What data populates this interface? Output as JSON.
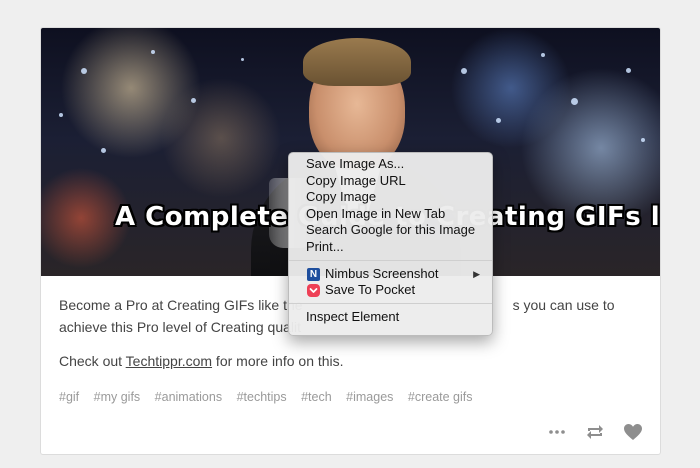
{
  "post": {
    "image_caption": "A Complete Guide to Creating GIFs like this",
    "paragraph1_start": "Become a Pro at Creating GIFs like the",
    "paragraph1_mid": "s you can use to",
    "paragraph1_line2": "achieve this Pro level of Creating qualit",
    "paragraph2_prefix": "Check out ",
    "paragraph2_link": "Techtippr.com",
    "paragraph2_suffix": " for more info on this.",
    "tags": [
      "#gif",
      "#my gifs",
      "#animations",
      "#techtips",
      "#tech",
      "#images",
      "#create gifs"
    ]
  },
  "actions": {
    "more_icon": "more-dots-icon",
    "reblog_icon": "reblog-icon",
    "like_icon": "heart-icon"
  },
  "context_menu": {
    "items": [
      "Save Image As...",
      "Copy Image URL",
      "Copy Image",
      "Open Image in New Tab",
      "Search Google for this Image",
      "Print..."
    ],
    "extensions": [
      {
        "label": "Nimbus Screenshot",
        "icon": "nimbus-icon",
        "has_submenu": true,
        "submenu_glyph": "▶"
      },
      {
        "label": "Save To Pocket",
        "icon": "pocket-icon",
        "has_submenu": false
      }
    ],
    "inspect": "Inspect Element"
  },
  "colors": {
    "page_bg": "#efefef",
    "card_bg": "#ffffff",
    "tag_color": "#9a9a9a",
    "pocket_red": "#ee4056",
    "nimbus_blue": "#1f4f9e"
  }
}
